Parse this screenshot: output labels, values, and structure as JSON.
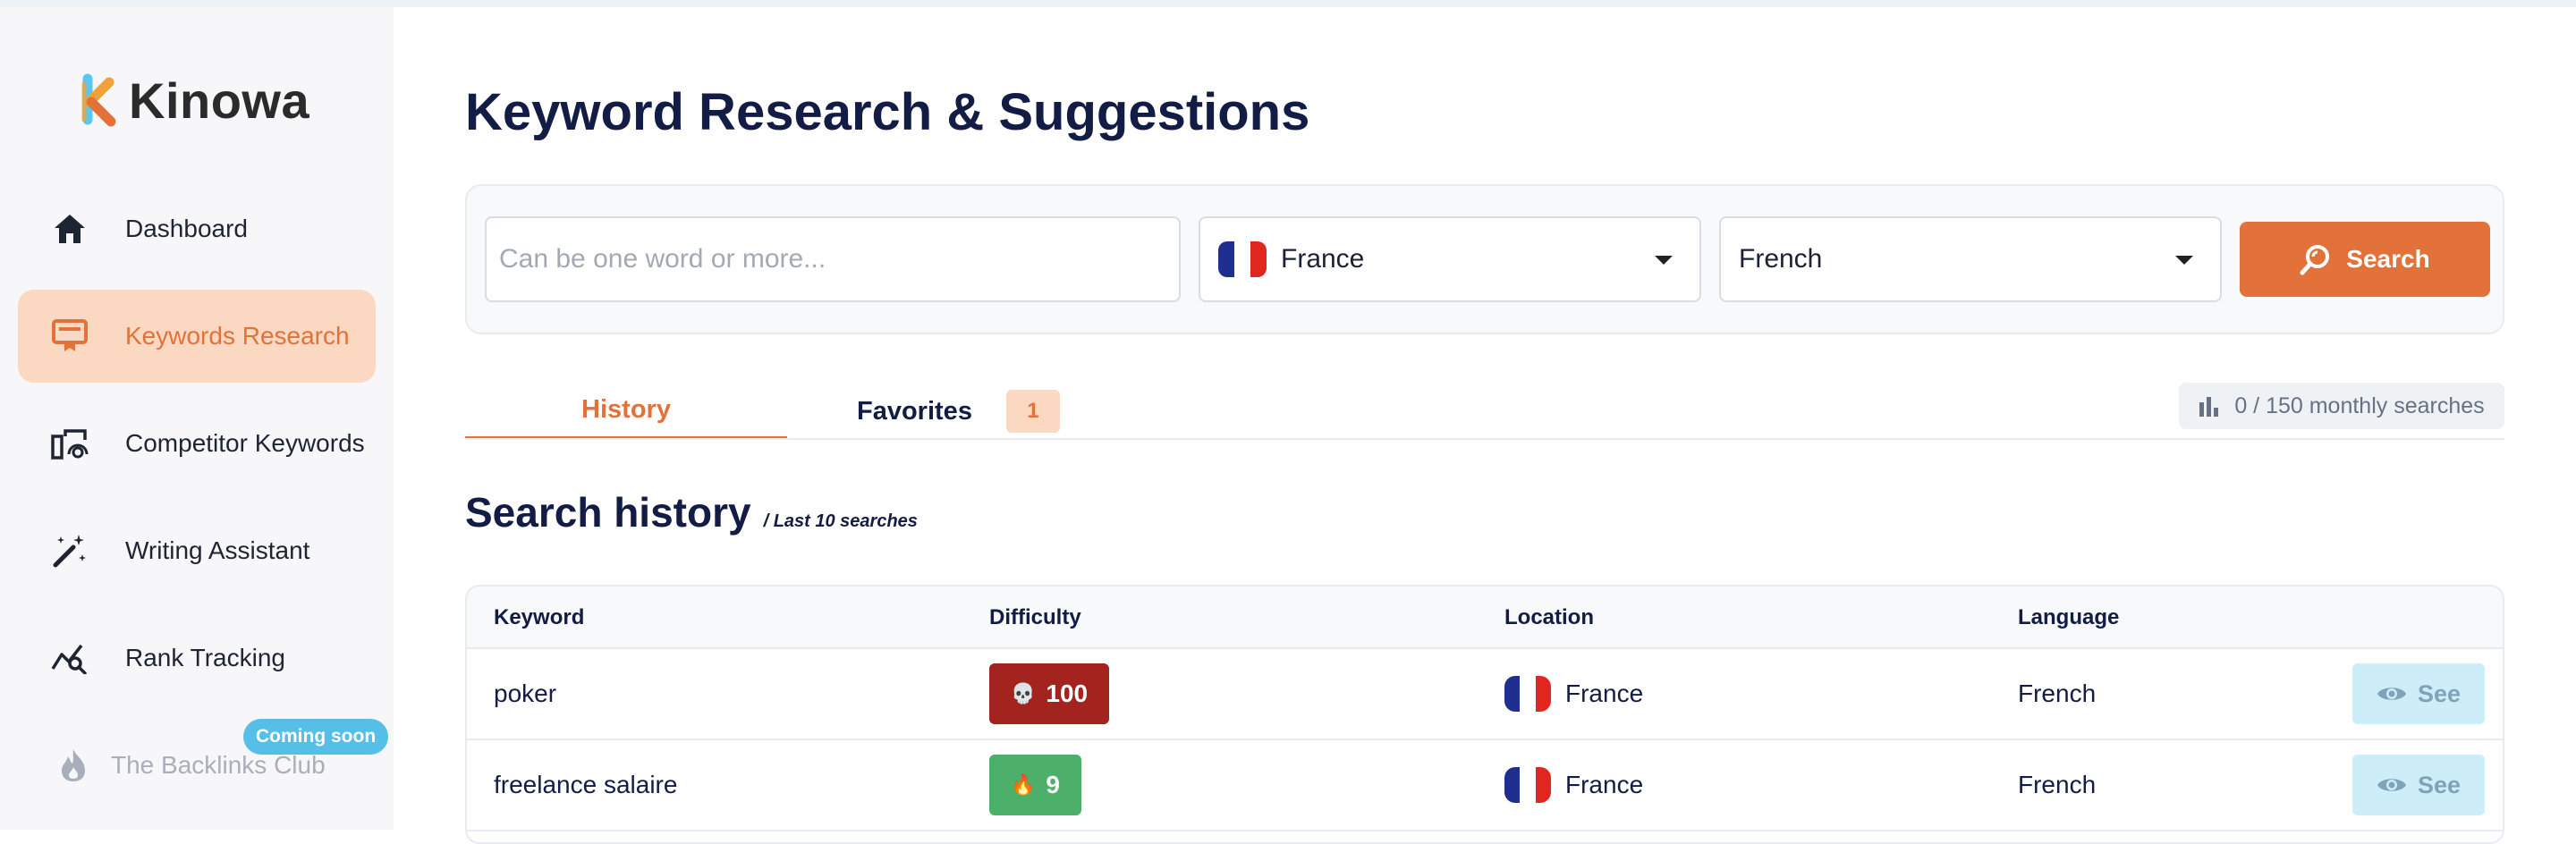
{
  "app": {
    "name": "Kinowa",
    "brand_color": "#e2723a",
    "accent_blue": "#56bfe8"
  },
  "sidebar": {
    "items": [
      {
        "label": "Dashboard",
        "icon": "home-icon",
        "active": false
      },
      {
        "label": "Keywords Research",
        "icon": "keywords-research-icon",
        "active": true
      },
      {
        "label": "Competitor Keywords",
        "icon": "competitor-icon",
        "active": false
      },
      {
        "label": "Writing Assistant",
        "icon": "magic-wand-icon",
        "active": false
      },
      {
        "label": "Rank Tracking",
        "icon": "rank-tracking-icon",
        "active": false
      },
      {
        "label": "The Backlinks Club",
        "icon": "fire-icon",
        "active": false,
        "disabled": true,
        "badge": "Coming soon"
      }
    ]
  },
  "page": {
    "title": "Keyword Research & Suggestions"
  },
  "search": {
    "placeholder": "Can be one word or more...",
    "country": "France",
    "language": "French",
    "button_label": "Search"
  },
  "tabs": {
    "history": "History",
    "favorites": "Favorites",
    "favorites_count": "1",
    "quota": "0 / 150 monthly searches"
  },
  "history": {
    "title": "Search history",
    "subtitle": "/ Last 10 searches",
    "columns": [
      "Keyword",
      "Difficulty",
      "Location",
      "Language"
    ],
    "rows": [
      {
        "keyword": "poker",
        "difficulty": "100",
        "difficulty_icon": "skull-icon",
        "difficulty_color": "#a3231f",
        "location": "France",
        "language": "French",
        "action": "See"
      },
      {
        "keyword": "freelance salaire",
        "difficulty": "9",
        "difficulty_icon": "fire-icon",
        "difficulty_color": "#4cb06a",
        "location": "France",
        "language": "French",
        "action": "See"
      }
    ]
  }
}
